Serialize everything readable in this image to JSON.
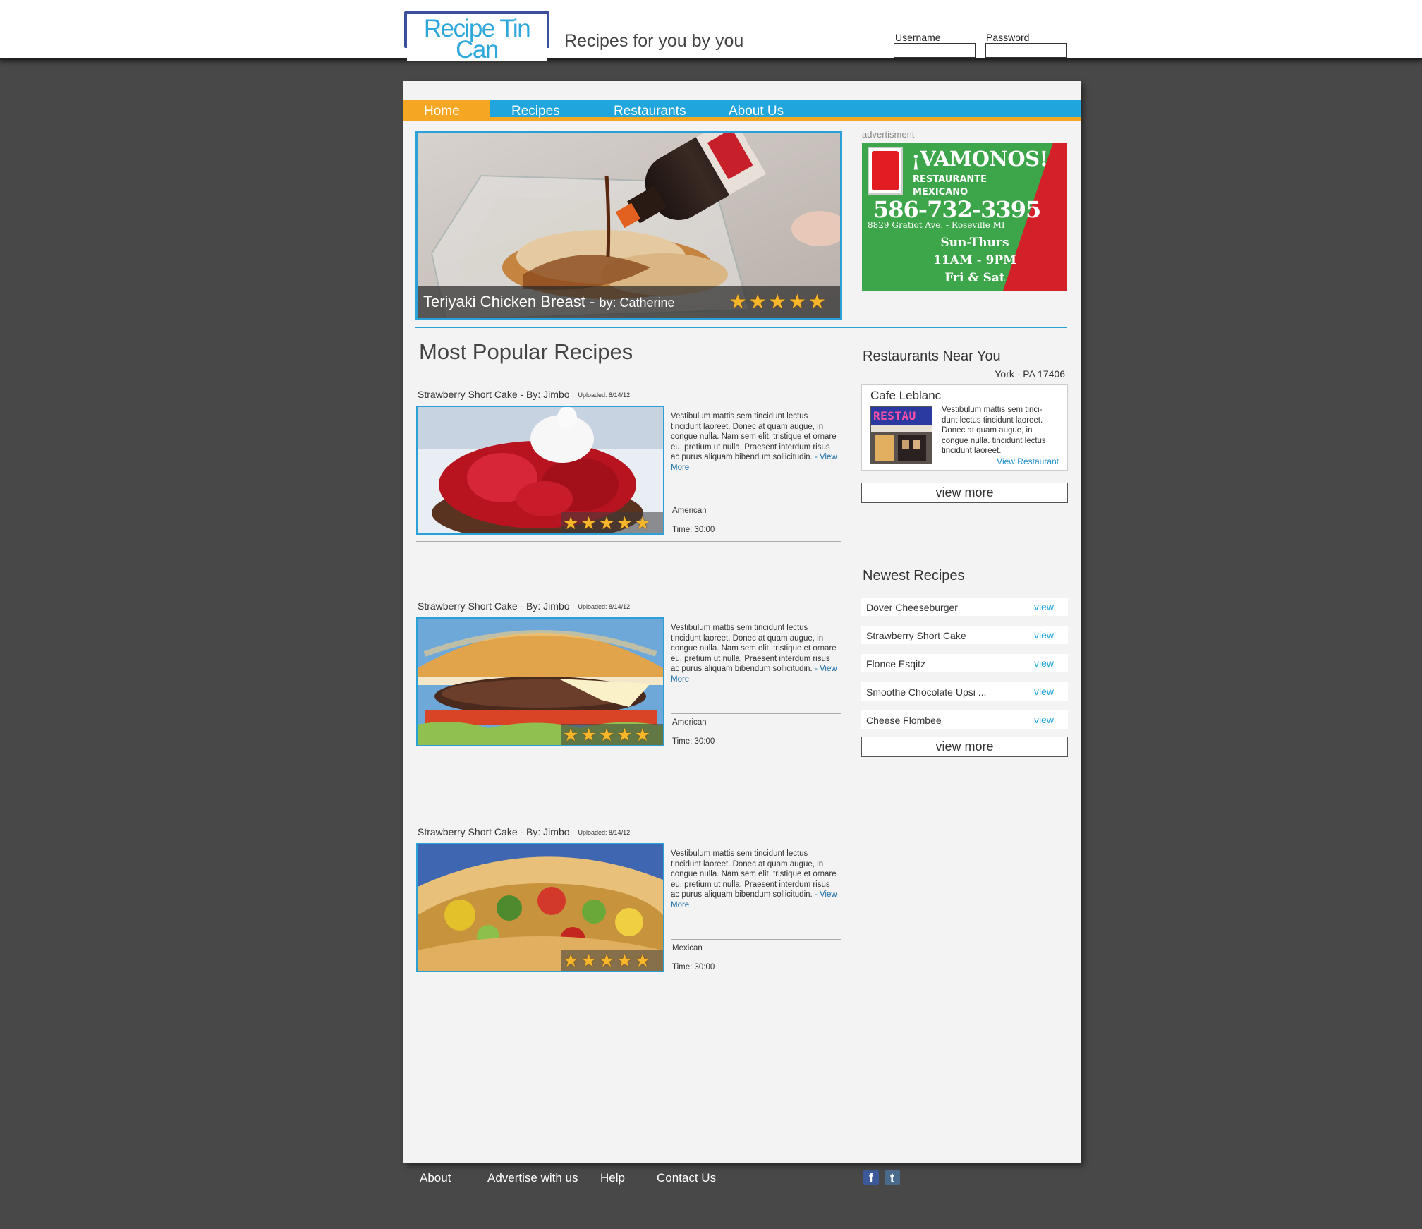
{
  "header": {
    "logo_text": "Recipe Tin Can",
    "tagline": "Recipes for you by you",
    "username_label": "Username",
    "password_label": "Password"
  },
  "nav": {
    "items": [
      {
        "label": "Home",
        "active": true
      },
      {
        "label": "Recipes",
        "active": false
      },
      {
        "label": "Restaurants",
        "active": false
      },
      {
        "label": "About Us",
        "active": false
      }
    ]
  },
  "featured": {
    "title": "Teriyaki Chicken Breast",
    "separator": " - ",
    "by": "by: Catherine",
    "rating": 5
  },
  "ad": {
    "label": "advertisment",
    "name": "¡VAMONOS!",
    "line1": "RESTAURANTE",
    "line2": "MEXICANO",
    "phone": "586-732-3395",
    "address": "8829 Gratiot Ave. - Roseville MI",
    "hours1": "Sun-Thurs",
    "hours2": "11AM - 9PM",
    "hours3": "Fri & Sat"
  },
  "popular": {
    "title": "Most Popular Recipes",
    "recipes": [
      {
        "title": "Strawberry Short Cake - By: Jimbo",
        "uploaded": "Uploaded: 8/14/12.",
        "description": "Vestibulum mattis sem tincidunt lectus tincidunt laoreet. Donec at quam augue, in congue nulla. Nam sem elit, tristique et ornare eu, pretium ut nulla. Praesent interdum risus ac purus aliquam bibendum sollicitudin.",
        "more_link": "- View More",
        "cuisine": "American",
        "time": "Time: 30:00",
        "rating": 5
      },
      {
        "title": "Strawberry Short Cake - By: Jimbo",
        "uploaded": "Uploaded: 8/14/12.",
        "description": "Vestibulum mattis sem tincidunt lectus tincidunt laoreet. Donec at quam augue, in congue nulla. Nam sem elit, tristique et ornare eu, pretium ut nulla. Praesent interdum risus ac purus aliquam bibendum sollicitudin.",
        "more_link": "- View More",
        "cuisine": "American",
        "time": "Time: 30:00",
        "rating": 5
      },
      {
        "title": "Strawberry Short Cake - By: Jimbo",
        "uploaded": "Uploaded: 8/14/12.",
        "description": "Vestibulum mattis sem tincidunt lectus tincidunt laoreet. Donec at quam augue, in congue nulla. Nam sem elit, tristique et ornare eu, pretium ut nulla. Praesent interdum risus ac purus aliquam bibendum sollicitudin.",
        "more_link": "- View More",
        "cuisine": "Mexican",
        "time": "Time: 30:00",
        "rating": 5
      }
    ]
  },
  "restaurants": {
    "title": "Restaurants Near You",
    "location": "York - PA 17406",
    "item": {
      "name": "Cafe Leblanc",
      "sign": "RESTAU",
      "description": "Vestibulum mattis sem tinci-dunt lectus tincidunt laoreet. Donec at quam augue, in congue nulla. tincidunt lectus tincidunt laoreet.",
      "link": "View Restaurant"
    },
    "view_more": "view more"
  },
  "newest": {
    "title": "Newest Recipes",
    "items": [
      {
        "name": "Dover Cheeseburger",
        "link": "view"
      },
      {
        "name": "Strawberry Short Cake",
        "link": "view"
      },
      {
        "name": "Flonce Esqitz",
        "link": "view"
      },
      {
        "name": "Smoothe Chocolate Upsi ...",
        "link": "view"
      },
      {
        "name": "Cheese Flombee",
        "link": "view"
      }
    ],
    "view_more": "view more"
  },
  "footer": {
    "links": [
      "About",
      "Advertise with us",
      "Help",
      "Contact Us"
    ],
    "social": [
      {
        "icon": "facebook-icon",
        "glyph": "f",
        "color": "#3b5998"
      },
      {
        "icon": "tumblr-icon",
        "glyph": "t",
        "color": "#4a6a8c"
      }
    ]
  },
  "colors": {
    "accent_blue": "#20a5dc",
    "accent_orange": "#f5a623",
    "star": "#f8b62a",
    "background": "#484848"
  }
}
